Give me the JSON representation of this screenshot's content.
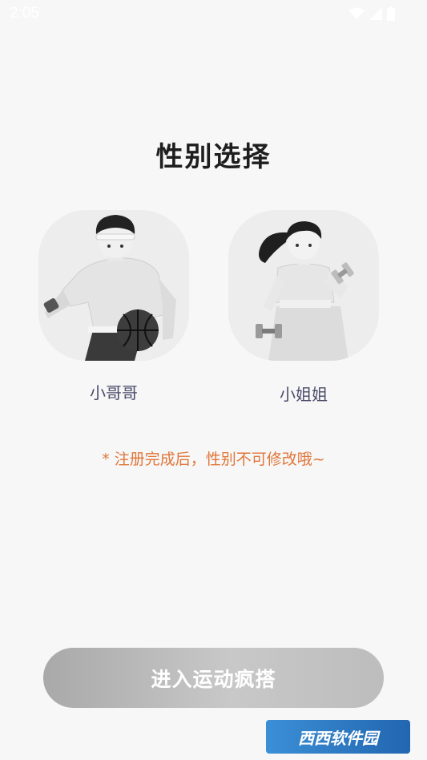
{
  "status_bar": {
    "time": "2:05",
    "icons": [
      "wifi-icon",
      "signal-icon",
      "battery-icon"
    ]
  },
  "page": {
    "title": "性别选择"
  },
  "genders": [
    {
      "label": "小哥哥",
      "avatar": "basketball-boy-avatar"
    },
    {
      "label": "小姐姐",
      "avatar": "dumbbell-girl-avatar"
    }
  ],
  "notice": "* 注册完成后，性别不可修改哦~",
  "enter_button": {
    "label": "进入运动疯搭"
  },
  "colors": {
    "background": "#f7f7f7",
    "title": "#1e1e1e",
    "label": "#4a4a6a",
    "notice": "#e0763a",
    "button_gradient_start": "#a9a9a9",
    "button_gradient_end": "#c8c8c8"
  },
  "watermark": {
    "text": "西西软件园"
  }
}
